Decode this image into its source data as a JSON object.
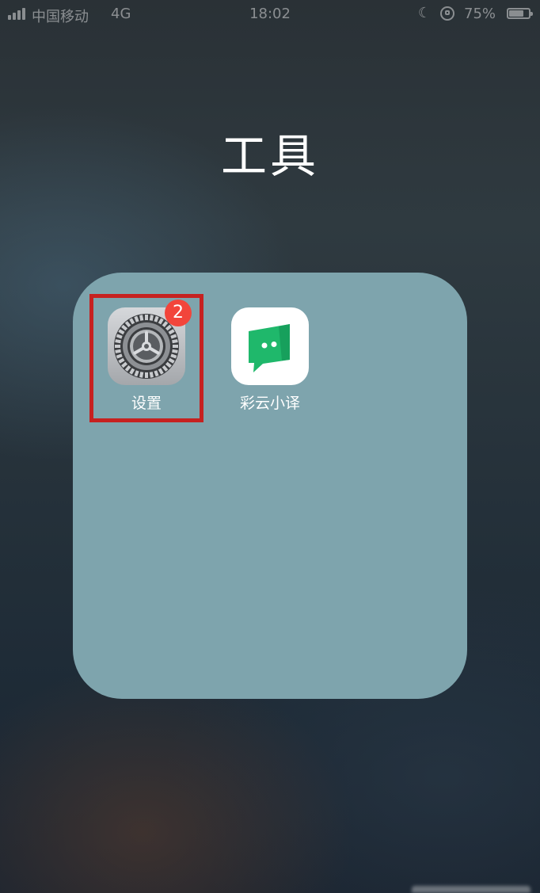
{
  "status_bar": {
    "carrier": "中国移动",
    "network": "4G",
    "time": "18:02",
    "battery": "75%",
    "battery_level": 0.75,
    "icons": [
      "signal-icon",
      "moon-icon",
      "orientation-lock-icon",
      "battery-icon"
    ]
  },
  "folder": {
    "title": "工具",
    "apps": [
      {
        "label": "设置",
        "icon": "settings-gear-icon",
        "badge": "2",
        "highlighted": true
      },
      {
        "label": "彩云小译",
        "icon": "caiyun-translate-icon"
      }
    ]
  },
  "colors": {
    "folder_panel": "#7ea4ad",
    "badge": "#f2453b",
    "highlight": "#c62120",
    "caiyun_green": "#1fb86b"
  }
}
